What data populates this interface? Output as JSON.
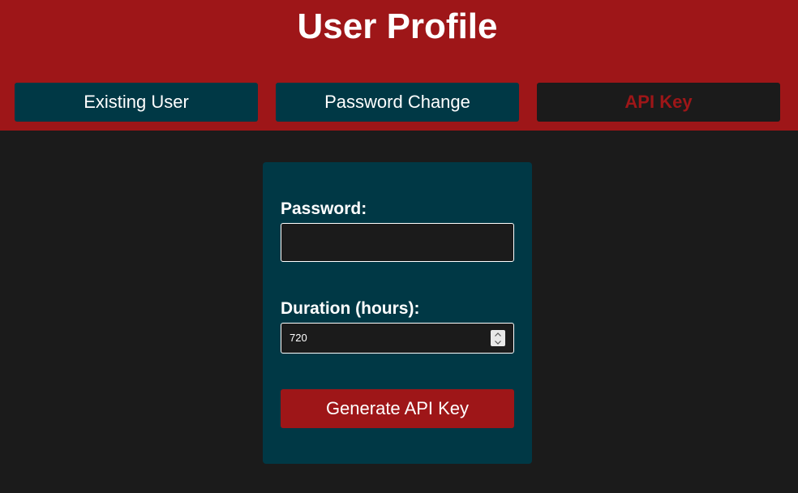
{
  "header": {
    "title": "User Profile",
    "background": "#9e1618"
  },
  "tabs": [
    {
      "label": "Existing User",
      "active": false
    },
    {
      "label": "Password Change",
      "active": false
    },
    {
      "label": "API Key",
      "active": true
    }
  ],
  "form": {
    "password_label": "Password:",
    "password_value": "",
    "duration_label": "Duration (hours):",
    "duration_value": "720",
    "submit_label": "Generate API Key"
  },
  "colors": {
    "accent": "#9e1618",
    "panel": "#003845",
    "background": "#1b1b1b",
    "text": "#ffffff"
  }
}
